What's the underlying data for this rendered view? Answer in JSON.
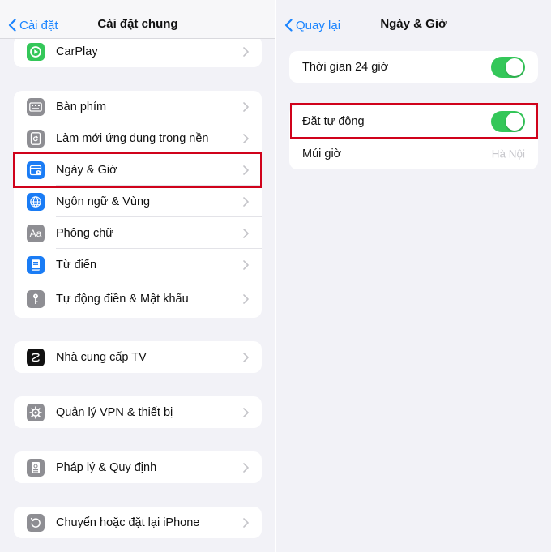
{
  "left": {
    "back_label": "Cài đặt",
    "title": "Cài đặt chung",
    "groups": [
      {
        "items": [
          {
            "label": "CarPlay",
            "icon": "carplay-icon"
          }
        ]
      },
      {
        "items": [
          {
            "label": "Bàn phím",
            "icon": "keyboard-icon"
          },
          {
            "label": "Làm mới ứng dụng trong nền",
            "icon": "background-refresh-icon"
          },
          {
            "label": "Ngày & Giờ",
            "icon": "calendar-clock-icon"
          },
          {
            "label": "Ngôn ngữ & Vùng",
            "icon": "globe-icon"
          },
          {
            "label": "Phông chữ",
            "icon": "fonts-icon"
          },
          {
            "label": "Từ điển",
            "icon": "dictionary-icon"
          },
          {
            "label": "Tự động điền & Mật khẩu",
            "icon": "key-icon"
          }
        ]
      },
      {
        "items": [
          {
            "label": "Nhà cung cấp TV",
            "icon": "tv-provider-icon"
          }
        ]
      },
      {
        "items": [
          {
            "label": "Quản lý VPN & thiết bị",
            "icon": "gear-icon"
          }
        ]
      },
      {
        "items": [
          {
            "label": "Pháp lý & Quy định",
            "icon": "legal-document-icon"
          }
        ]
      },
      {
        "items": [
          {
            "label": "Chuyển hoặc đặt lại iPhone",
            "icon": "reset-icon"
          }
        ]
      }
    ]
  },
  "right": {
    "back_label": "Quay lại",
    "title": "Ngày & Giờ",
    "time_24h": {
      "label": "Thời gian 24 giờ",
      "on": true
    },
    "auto_set": {
      "label": "Đặt tự động",
      "on": true
    },
    "time_zone": {
      "label": "Múi giờ",
      "value": "Hà Nội"
    }
  },
  "colors": {
    "accent": "#1a84ff",
    "toggle_on": "#34c759",
    "highlight": "#d0021b",
    "background": "#f2f2f7",
    "carplay_green": "#34c759",
    "date_blue": "#1a7cf5",
    "icon_gray": "#8e8e93",
    "tv_black": "#111111"
  }
}
